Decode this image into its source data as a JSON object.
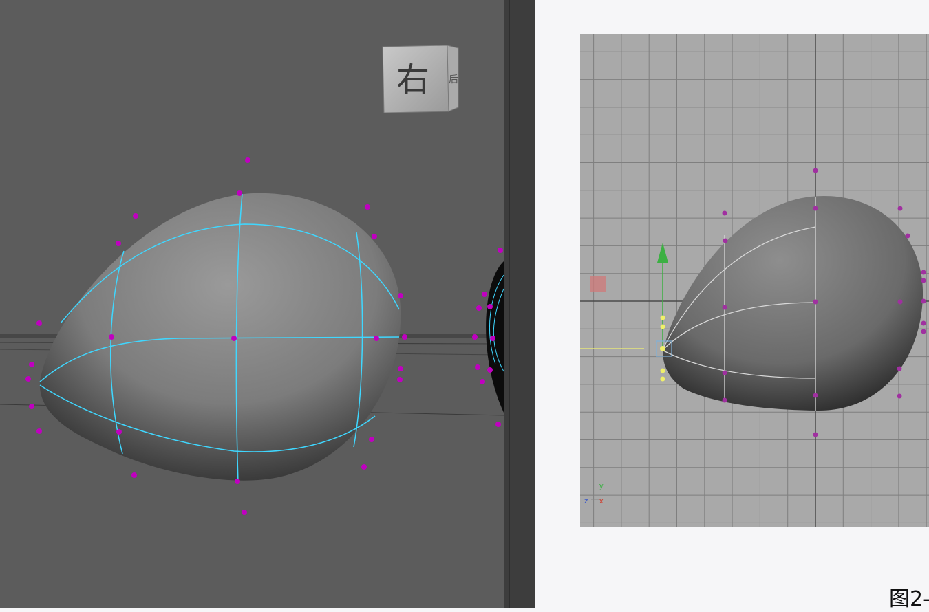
{
  "left_viewport": {
    "view_cube": {
      "face_label": "右",
      "side_label": "后"
    }
  },
  "right_viewport": {
    "axis_indicator": {
      "y": "y",
      "z": "z",
      "x": "x"
    }
  },
  "caption": "图2-",
  "colors": {
    "viewport_bg": "#5c5c5c",
    "grid_bg": "#a9a9a9",
    "control_point": "#c000c0",
    "isoparm": "#3fd7ff",
    "y_axis_arrow": "#3cb043",
    "pivot": "#f0f06a"
  }
}
